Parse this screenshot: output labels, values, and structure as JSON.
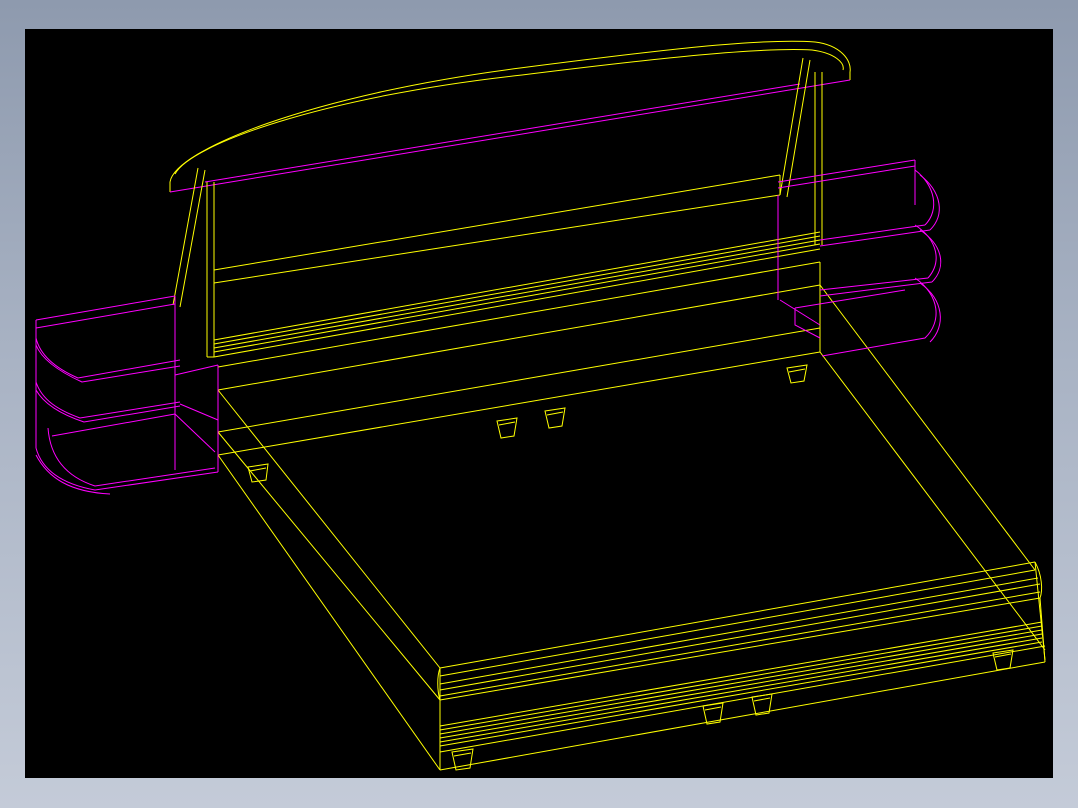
{
  "window": {
    "background": "#9aa5b8"
  },
  "viewport": {
    "background": "#000000"
  },
  "colors": {
    "bed_lines": "#ffff00",
    "nightstand_lines": "#ff00ff"
  },
  "drawing": {
    "subject": "bed-with-nightstands-wireframe",
    "parts": [
      "headboard",
      "headboard-posts",
      "bed-frame",
      "mattress",
      "footboard-edge",
      "bed-feet",
      "left-nightstand",
      "right-nightstand"
    ],
    "feet_count": 8
  }
}
